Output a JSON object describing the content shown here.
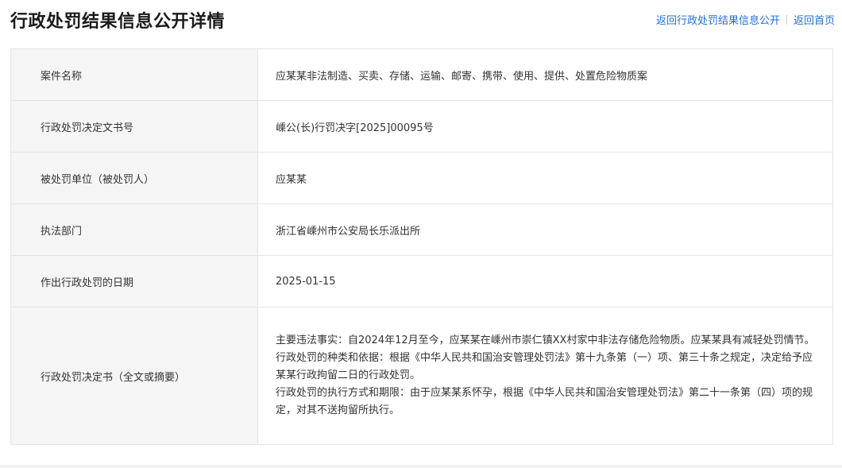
{
  "page": {
    "title": "行政处罚结果信息公开详情",
    "links": {
      "back_to_list": "返回行政处罚结果信息公开",
      "back_home": "返回首页"
    }
  },
  "details": [
    {
      "label": "案件名称",
      "value": "应某某非法制造、买卖、存储、运输、邮寄、携带、使用、提供、处置危险物质案"
    },
    {
      "label": "行政处罚决定文书号",
      "value": "嵊公(长)行罚决字[2025]00095号"
    },
    {
      "label": "被处罚单位（被处罚人）",
      "value": "应某某"
    },
    {
      "label": "执法部门",
      "value": "浙江省嵊州市公安局长乐派出所"
    },
    {
      "label": "作出行政处罚的日期",
      "value": "2025-01-15"
    }
  ],
  "decision": {
    "label": "行政处罚决定书（全文或摘要）",
    "paragraphs": [
      "主要违法事实：自2024年12月至今，应某某在嵊州市崇仁镇XX村家中非法存储危险物质。应某某具有减轻处罚情节。",
      "行政处罚的种类和依据：根据《中华人民共和国治安管理处罚法》第十九条第（一）项、第三十条之规定，决定给予应某某行政拘留二日的行政处罚。",
      "行政处罚的执行方式和期限：由于应某某系怀孕，根据《中华人民共和国治安管理处罚法》第二十一条第（四）项的规定，对其不送拘留所执行。"
    ]
  },
  "colors": {
    "link": "#1e6fd9",
    "label_bg": "#f5f5f5",
    "border": "#e4e4e4"
  }
}
